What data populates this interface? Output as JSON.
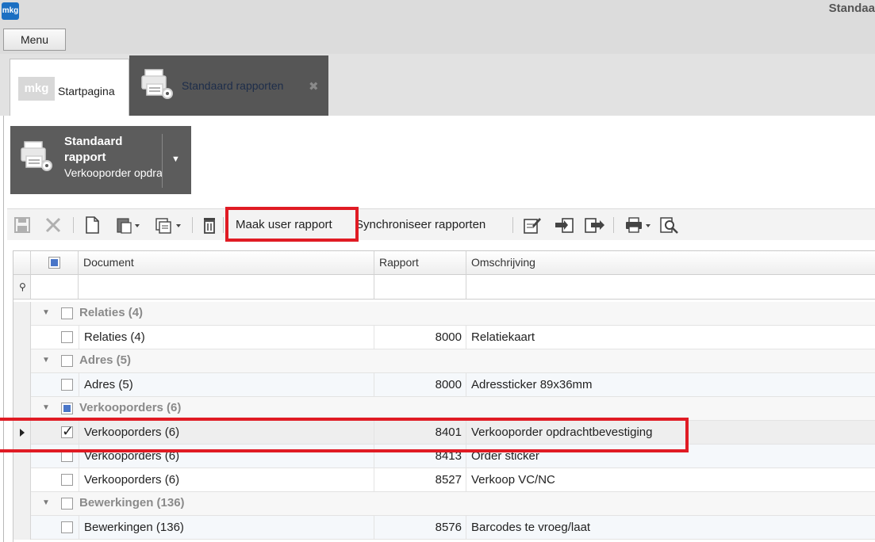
{
  "window": {
    "title": "Standaa",
    "logo_text": "mkg"
  },
  "menu": {
    "label": "Menu"
  },
  "tabs": [
    {
      "label": "Startpagina",
      "logo_text": "mkg"
    },
    {
      "label": "Standaard rapporten",
      "close": "✖"
    }
  ],
  "report_selector": {
    "title": "Standaard rapport",
    "subtitle": "Verkooporder opdrachtbevestigi",
    "arrow": "▼"
  },
  "toolbar": {
    "make_user_report": "Maak user rapport",
    "sync_reports": "Synchroniseer rapporten"
  },
  "grid": {
    "columns": [
      "Document",
      "Rapport",
      "Omschrijving"
    ],
    "filter_icon": "⚲",
    "groups": [
      {
        "title": "Relaties (4)",
        "rows": [
          {
            "document": "Relaties (4)",
            "rapport": "8000",
            "omschrijving": "Relatiekaart"
          }
        ]
      },
      {
        "title": "Adres (5)",
        "rows": [
          {
            "document": "Adres (5)",
            "rapport": "8000",
            "omschrijving": "Adressticker 89x36mm"
          }
        ]
      },
      {
        "title": "Verkooporders (6)",
        "rows": [
          {
            "document": "Verkooporders (6)",
            "rapport": "8401",
            "omschrijving": "Verkooporder opdrachtbevestiging"
          },
          {
            "document": "Verkooporders (6)",
            "rapport": "8413",
            "omschrijving": "Order sticker"
          },
          {
            "document": "Verkooporders (6)",
            "rapport": "8527",
            "omschrijving": "Verkoop VC/NC"
          }
        ]
      },
      {
        "title": "Bewerkingen (136)",
        "rows": [
          {
            "document": "Bewerkingen (136)",
            "rapport": "8576",
            "omschrijving": "Barcodes te vroeg/laat"
          }
        ]
      }
    ]
  },
  "colors": {
    "highlight": "#e01b24",
    "accent": "#4a76c8",
    "tab_active": "#565656"
  }
}
